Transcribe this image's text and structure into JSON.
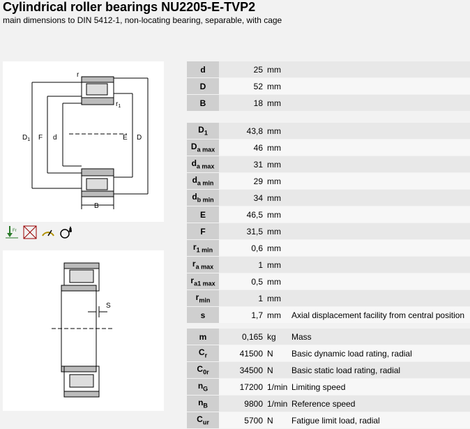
{
  "title": "Cylindrical roller bearings NU2205-E-TVP2",
  "subtitle": "main dimensions to DIN 5412-1, non-locating bearing, separable, with cage",
  "drawing1_labels": {
    "r": "r",
    "r1": "r",
    "r1_sub": "1",
    "D1": "D",
    "D1_sub": "1",
    "F": "F",
    "d": "d",
    "E": "E",
    "D": "D",
    "B": "B"
  },
  "drawing2_labels": {
    "s": "S"
  },
  "icon_names": [
    "radial-load-icon",
    "no-axial-load-icon",
    "speed-icon",
    "lubrication-icon"
  ],
  "group1": [
    {
      "sym": "d",
      "sub": "",
      "value": "25",
      "unit": "mm",
      "desc": ""
    },
    {
      "sym": "D",
      "sub": "",
      "value": "52",
      "unit": "mm",
      "desc": ""
    },
    {
      "sym": "B",
      "sub": "",
      "value": "18",
      "unit": "mm",
      "desc": ""
    }
  ],
  "group2": [
    {
      "sym": "D",
      "sub": "1",
      "value": "43,8",
      "unit": "mm",
      "desc": ""
    },
    {
      "sym": "D",
      "sub": "a max",
      "value": "46",
      "unit": "mm",
      "desc": ""
    },
    {
      "sym": "d",
      "sub": "a max",
      "value": "31",
      "unit": "mm",
      "desc": ""
    },
    {
      "sym": "d",
      "sub": "a min",
      "value": "29",
      "unit": "mm",
      "desc": ""
    },
    {
      "sym": "d",
      "sub": "b min",
      "value": "34",
      "unit": "mm",
      "desc": ""
    },
    {
      "sym": "E",
      "sub": "",
      "value": "46,5",
      "unit": "mm",
      "desc": ""
    },
    {
      "sym": "F",
      "sub": "",
      "value": "31,5",
      "unit": "mm",
      "desc": ""
    },
    {
      "sym": "r",
      "sub": "1 min",
      "value": "0,6",
      "unit": "mm",
      "desc": ""
    },
    {
      "sym": "r",
      "sub": "a max",
      "value": "1",
      "unit": "mm",
      "desc": ""
    },
    {
      "sym": "r",
      "sub": "a1 max",
      "value": "0,5",
      "unit": "mm",
      "desc": ""
    },
    {
      "sym": "r",
      "sub": "min",
      "value": "1",
      "unit": "mm",
      "desc": ""
    },
    {
      "sym": "s",
      "sub": "",
      "value": "1,7",
      "unit": "mm",
      "desc": "Axial displacement facility from central position"
    }
  ],
  "group3": [
    {
      "sym": "m",
      "sub": "",
      "value": "0,165",
      "unit": "kg",
      "desc": "Mass"
    },
    {
      "sym": "C",
      "sub": "r",
      "value": "41500",
      "unit": "N",
      "desc": "Basic dynamic load rating, radial"
    },
    {
      "sym": "C",
      "sub": "0r",
      "value": "34500",
      "unit": "N",
      "desc": "Basic static load rating, radial"
    },
    {
      "sym": "n",
      "sub": "G",
      "value": "17200",
      "unit": "1/min",
      "desc": "Limiting speed"
    },
    {
      "sym": "n",
      "sub": "B",
      "value": "9800",
      "unit": "1/min",
      "desc": "Reference speed"
    },
    {
      "sym": "C",
      "sub": "ur",
      "value": "5700",
      "unit": "N",
      "desc": "Fatigue limit load, radial"
    }
  ]
}
